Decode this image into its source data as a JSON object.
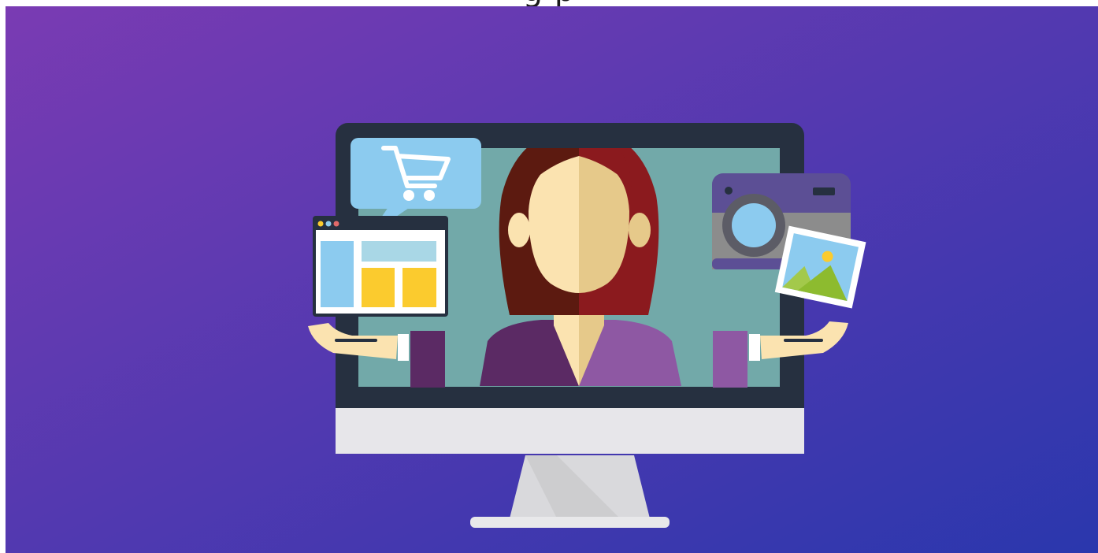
{
  "header": {
    "title_fragment": "g p"
  },
  "illustration": {
    "subject": "woman-in-monitor",
    "icons": [
      "shopping-cart-icon",
      "web-page-icon",
      "camera-icon",
      "picture-icon"
    ]
  },
  "colors": {
    "bg_top_left": "#7a3bb3",
    "bg_bottom_right": "#2a37ad",
    "screen": "#72a9a9",
    "monitor_bezel": "#263040",
    "monitor_chin": "#e7e6ea",
    "stand": "#d9d9dc",
    "hair_dark": "#5c1a10",
    "hair_light": "#8b1a1e",
    "skin_light": "#fbe3b0",
    "skin_dark": "#e6c98a",
    "shirt_dark": "#5b2a64",
    "shirt_light": "#8e58a3",
    "cart_bubble": "#8ccbef",
    "card_yellow": "#fbcb2e",
    "camera_body": "#5c4f95"
  }
}
